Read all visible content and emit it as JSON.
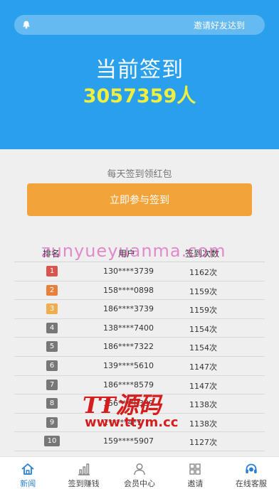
{
  "notice": {
    "text": "邀请好友达到"
  },
  "hero": {
    "title": "当前签到",
    "count": "3057359人"
  },
  "signin": {
    "subtitle": "每天签到领红包",
    "button_label": "立即参与签到"
  },
  "watermark": "zunyueyuanma.com",
  "ranking": {
    "headers": [
      "排名",
      "用户",
      "签到次数"
    ],
    "rows": [
      {
        "rank": "1",
        "user": "130****3739",
        "count": "1162次",
        "badge_color": "#d9534f"
      },
      {
        "rank": "2",
        "user": "158****0898",
        "count": "1159次",
        "badge_color": "#e8803a"
      },
      {
        "rank": "3",
        "user": "186****3739",
        "count": "1159次",
        "badge_color": "#f0ad4e"
      },
      {
        "rank": "4",
        "user": "138****7400",
        "count": "1154次",
        "badge_color": "#777777"
      },
      {
        "rank": "5",
        "user": "186****7322",
        "count": "1154次",
        "badge_color": "#777777"
      },
      {
        "rank": "6",
        "user": "139****5610",
        "count": "1147次",
        "badge_color": "#777777"
      },
      {
        "rank": "7",
        "user": "186****8579",
        "count": "1147次",
        "badge_color": "#777777"
      },
      {
        "rank": "8",
        "user": "156****8339",
        "count": "1138次",
        "badge_color": "#777777"
      },
      {
        "rank": "9",
        "user": "1*****4*7",
        "count": "1138次",
        "badge_color": "#777777"
      },
      {
        "rank": "10",
        "user": "159****5907",
        "count": "1127次",
        "badge_color": "#777777"
      }
    ]
  },
  "brand": {
    "logo": "TT源码",
    "site": "www.ttym.cc"
  },
  "tabbar": {
    "items": [
      {
        "label": "新闻",
        "icon": "home-icon",
        "active": true
      },
      {
        "label": "签到赚钱",
        "icon": "bar-chart-icon",
        "active": false
      },
      {
        "label": "会员中心",
        "icon": "user-icon",
        "active": false
      },
      {
        "label": "邀请",
        "icon": "grid-icon",
        "active": false
      },
      {
        "label": "在线客服",
        "icon": "headset-icon",
        "active": false
      }
    ]
  },
  "colors": {
    "hero_bg": "#2aa0ec",
    "count_yellow": "#f1ee3e",
    "button_orange": "#f2a33a",
    "active_tab": "#2a7fd4"
  }
}
